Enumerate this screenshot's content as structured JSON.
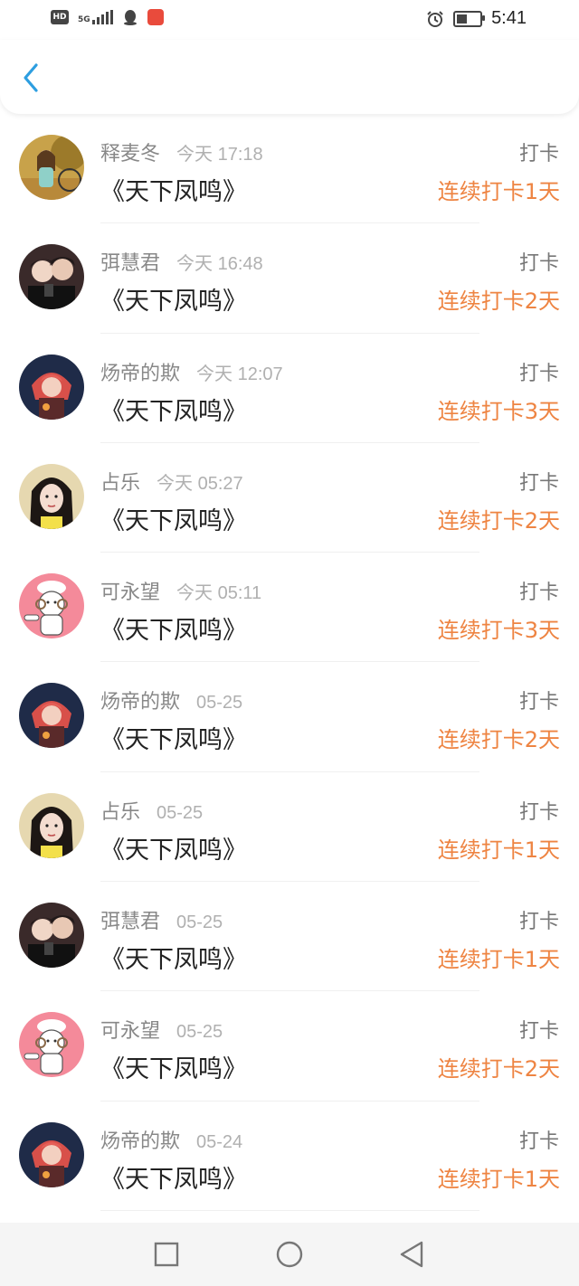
{
  "status_bar": {
    "time": "5:41",
    "hd_label": "HD",
    "network": "5G",
    "battery_level": 0.45,
    "icons": [
      "hd-icon",
      "signal-icon",
      "qq-icon",
      "app-notification-icon",
      "alarm-icon",
      "battery-icon"
    ]
  },
  "header": {
    "back_icon": "chevron-left-icon",
    "accent_color": "#2d9ee0"
  },
  "colors": {
    "streak": "#ee8442",
    "name": "#888888",
    "time": "#b0b0b0",
    "book": "#222222"
  },
  "records": [
    {
      "name": "释麦冬",
      "time": "今天 17:18",
      "book": "《天下凤鸣》",
      "tag": "打卡",
      "streak": "连续打卡1天",
      "avatar": "autumn-girl-avatar"
    },
    {
      "name": "弭慧君",
      "time": "今天 16:48",
      "book": "《天下凤鸣》",
      "tag": "打卡",
      "streak": "连续打卡2天",
      "avatar": "couple-avatar"
    },
    {
      "name": "炀帝的欺",
      "time": "今天 12:07",
      "book": "《天下凤鸣》",
      "tag": "打卡",
      "streak": "连续打卡3天",
      "avatar": "anime-red-hair-avatar"
    },
    {
      "name": "占乐",
      "time": "今天 05:27",
      "book": "《天下凤鸣》",
      "tag": "打卡",
      "streak": "连续打卡2天",
      "avatar": "girl-portrait-avatar"
    },
    {
      "name": "可永望",
      "time": "今天 05:11",
      "book": "《天下凤鸣》",
      "tag": "打卡",
      "streak": "连续打卡3天",
      "avatar": "cartoon-sheep-avatar"
    },
    {
      "name": "炀帝的欺",
      "time": "05-25",
      "book": "《天下凤鸣》",
      "tag": "打卡",
      "streak": "连续打卡2天",
      "avatar": "anime-red-hair-avatar"
    },
    {
      "name": "占乐",
      "time": "05-25",
      "book": "《天下凤鸣》",
      "tag": "打卡",
      "streak": "连续打卡1天",
      "avatar": "girl-portrait-avatar"
    },
    {
      "name": "弭慧君",
      "time": "05-25",
      "book": "《天下凤鸣》",
      "tag": "打卡",
      "streak": "连续打卡1天",
      "avatar": "couple-avatar"
    },
    {
      "name": "可永望",
      "time": "05-25",
      "book": "《天下凤鸣》",
      "tag": "打卡",
      "streak": "连续打卡2天",
      "avatar": "cartoon-sheep-avatar"
    },
    {
      "name": "炀帝的欺",
      "time": "05-24",
      "book": "《天下凤鸣》",
      "tag": "打卡",
      "streak": "连续打卡1天",
      "avatar": "anime-red-hair-avatar"
    }
  ],
  "nav_bar": {
    "icons": [
      "recents-square-icon",
      "home-circle-icon",
      "back-triangle-icon"
    ]
  }
}
